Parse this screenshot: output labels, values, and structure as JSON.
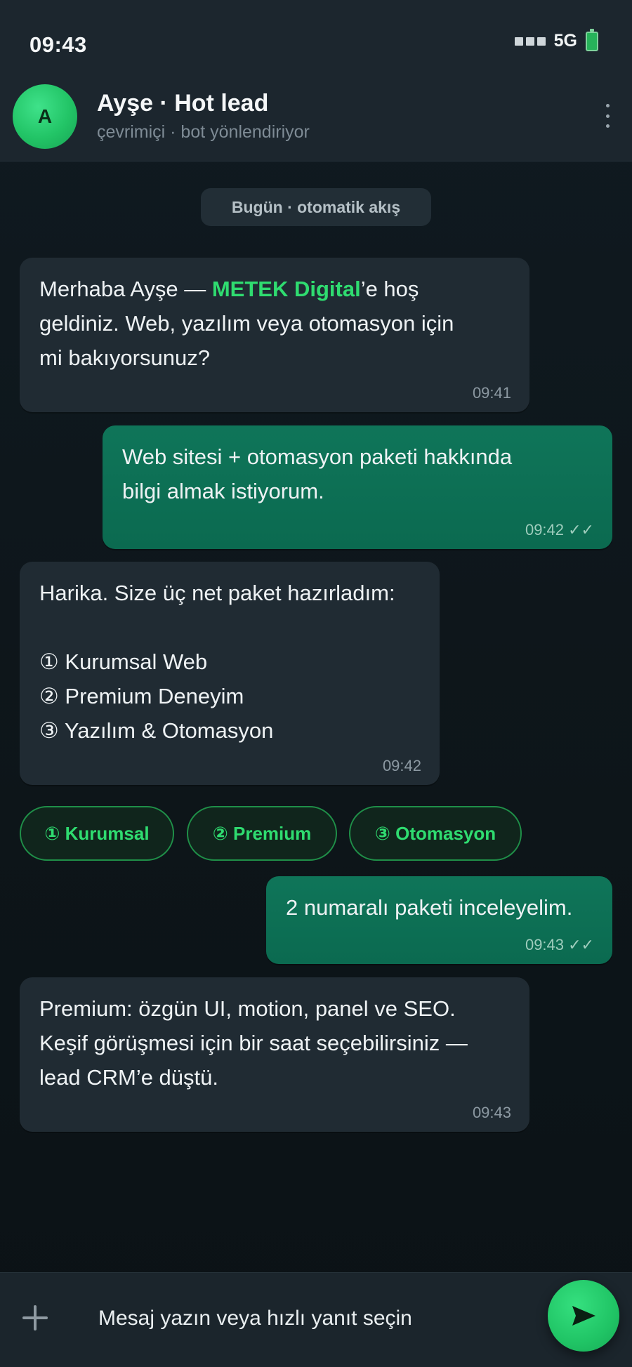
{
  "status_bar": {
    "time": "09:43",
    "network": "5G"
  },
  "header": {
    "avatar_letter": "A",
    "contact_name": "Ayşe · Hot lead",
    "contact_status": "çevrimiçi · bot yönlendiriyor"
  },
  "date_chip": "Bugün · otomatik akış",
  "messages": [
    {
      "direction": "incoming",
      "text_before": "Merhaba Ayşe — ",
      "brand": "METEK Digital",
      "text_after": "’e hoş\ngeldiniz. Web, yazılım veya otomasyon için\nmi bakıyorsunuz?",
      "time": "09:41"
    },
    {
      "direction": "outgoing",
      "text": "Web sitesi + otomasyon paketi hakkında\nbilgi almak istiyorum.",
      "time": "09:42 ✓✓"
    },
    {
      "direction": "incoming",
      "text": "Harika. Size üç net paket hazırladım:\n\n① Kurumsal Web\n② Premium Deneyim\n③ Yazılım & Otomasyon",
      "time": "09:42"
    },
    {
      "direction": "outgoing",
      "text": "2 numaralı paketi inceleyelim.",
      "time": "09:43 ✓✓"
    },
    {
      "direction": "incoming",
      "text": "Premium: özgün UI, motion, panel ve SEO.\nKeşif görüşmesi için bir saat seçebilirsiniz —\nlead CRM’e düştü.",
      "time": "09:43"
    }
  ],
  "quick_replies": [
    "① Kurumsal",
    "② Premium",
    "③ Otomasyon"
  ],
  "composer": {
    "placeholder": "Mesaj yazın veya hızlı yanıt seçin"
  },
  "colors": {
    "accent": "#2fdc70",
    "outgoing_bubble": "#0f7559",
    "incoming_bubble": "#202b33"
  }
}
